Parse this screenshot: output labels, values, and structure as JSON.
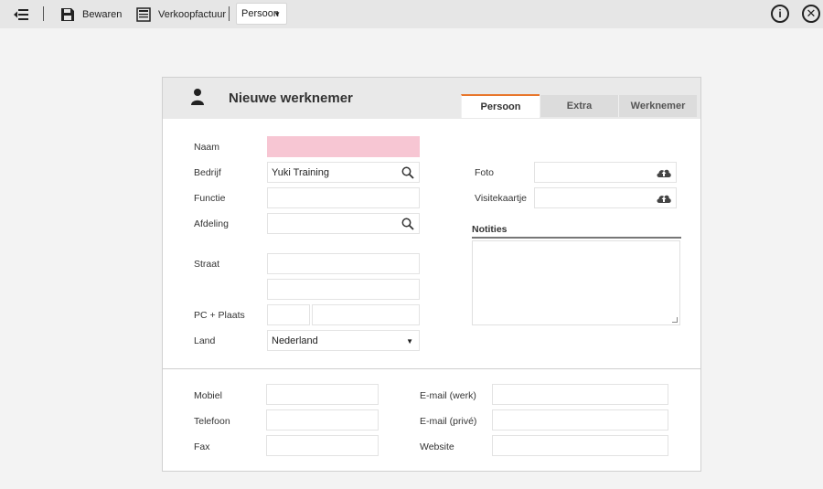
{
  "toolbar": {
    "back_icon": "collapse-left-icon",
    "save_label": "Bewaren",
    "save_icon": "floppy-disk-icon",
    "invoice_label": "Verkoopfactuur",
    "invoice_icon": "invoice-icon",
    "view_select_value": "Persoon",
    "info_icon": "info-icon",
    "close_icon": "close-icon"
  },
  "card": {
    "title": "Nieuwe werknemer",
    "tabs": [
      {
        "label": "Persoon",
        "active": true
      },
      {
        "label": "Extra",
        "active": false
      },
      {
        "label": "Werknemer",
        "active": false
      }
    ]
  },
  "form": {
    "naam_label": "Naam",
    "naam_value": "",
    "bedrijf_label": "Bedrijf",
    "bedrijf_value": "Yuki Training",
    "functie_label": "Functie",
    "afdeling_label": "Afdeling",
    "straat_label": "Straat",
    "pc_plaats_label": "PC + Plaats",
    "land_label": "Land",
    "land_value": "Nederland",
    "foto_label": "Foto",
    "visitekaartje_label": "Visitekaartje",
    "notities_label": "Notities"
  },
  "contact": {
    "mobiel_label": "Mobiel",
    "telefoon_label": "Telefoon",
    "fax_label": "Fax",
    "email_werk_label": "E-mail (werk)",
    "email_prive_label": "E-mail (privé)",
    "website_label": "Website"
  },
  "colors": {
    "accent": "#e8762b",
    "required_field": "#f7c6d3"
  }
}
